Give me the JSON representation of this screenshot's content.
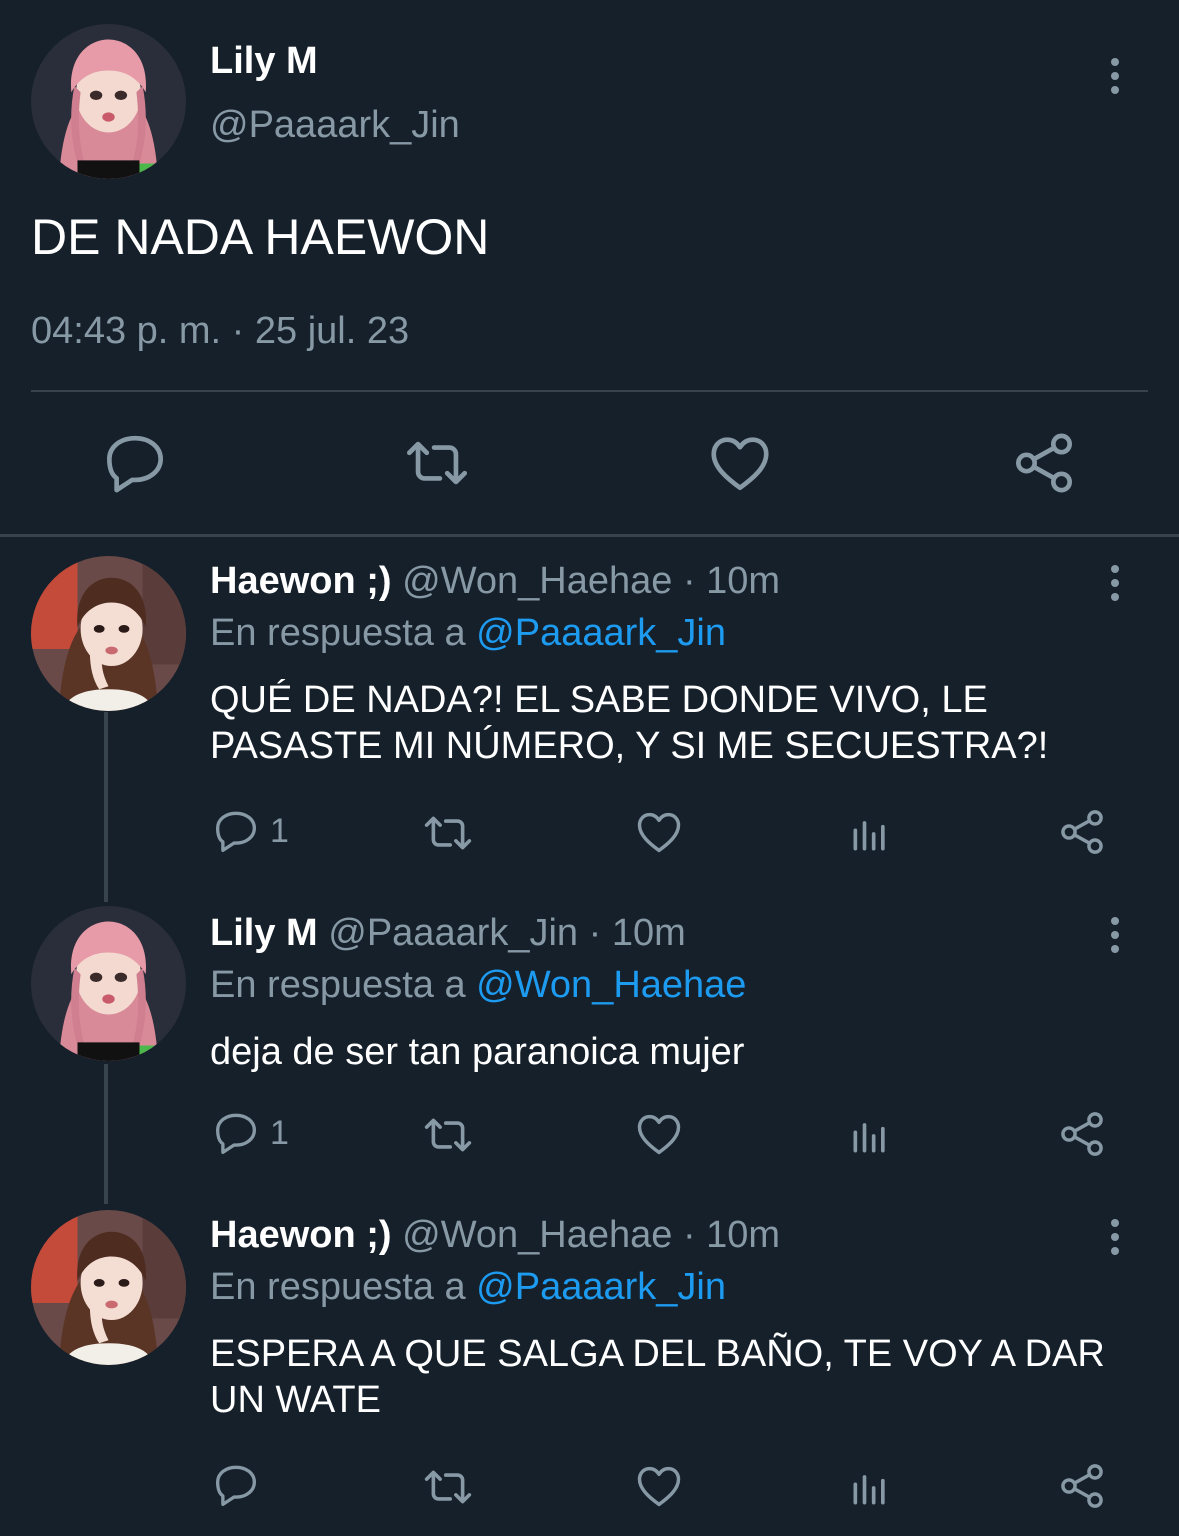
{
  "main_tweet": {
    "display_name": "Lily M",
    "handle": "@Paaaark_Jin",
    "text": "DE NADA HAEWON",
    "timestamp": "04:43 p. m. · 25 jul. 23",
    "actions": [
      "reply-icon",
      "retweet-icon",
      "like-icon",
      "share-icon"
    ]
  },
  "replies": [
    {
      "display_name": "Haewon ;)",
      "meta": "@Won_Haehae · 10m",
      "reply_prefix": "En respuesta a",
      "reply_to": "@Paaaark_Jin",
      "text_line1": "QUÉ DE NADA?! EL SABE DONDE VIVO, LE",
      "text_line2": "PASASTE MI NÚMERO, Y SI ME SECUESTRA?!",
      "reply_count": "1"
    },
    {
      "display_name": "Lily M",
      "meta": "@Paaaark_Jin · 10m",
      "reply_prefix": "En respuesta a",
      "reply_to": "@Won_Haehae",
      "text_line1": "deja de ser tan paranoica mujer",
      "reply_count": "1"
    },
    {
      "display_name": "Haewon ;)",
      "meta": "@Won_Haehae · 10m",
      "reply_prefix": "En respuesta a",
      "reply_to": "@Paaaark_Jin",
      "text_line1": "ESPERA A QUE SALGA DEL BAÑO, TE VOY A DAR",
      "text_line2": "UN WATE"
    }
  ],
  "colors": {
    "background": "#15202b",
    "muted": "#8899a6",
    "link": "#1d9bf0",
    "divider": "#38444d"
  }
}
